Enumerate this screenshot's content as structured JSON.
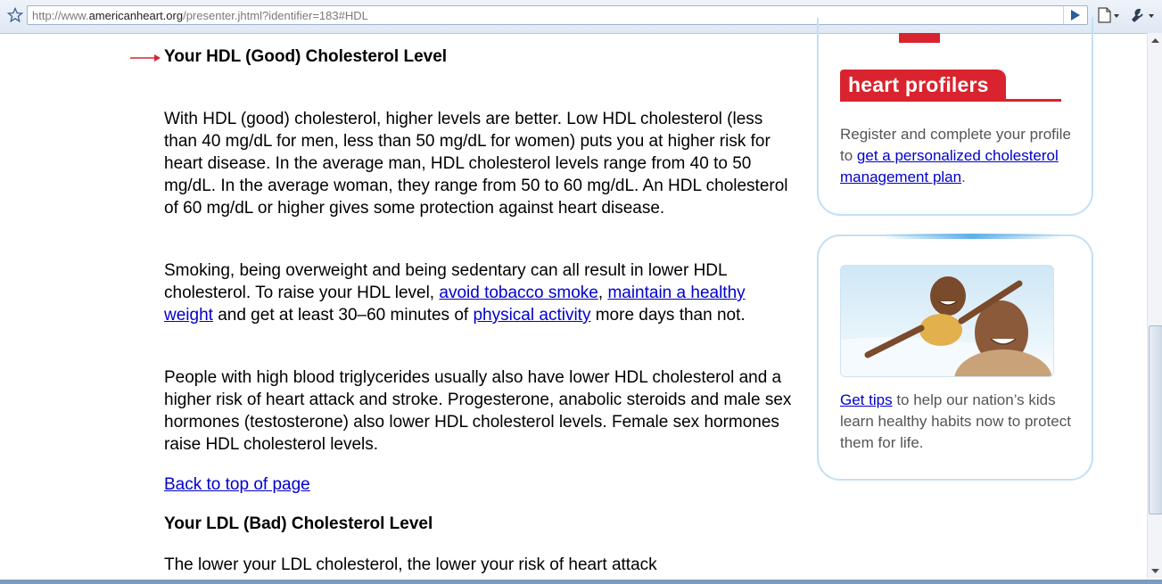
{
  "browser": {
    "url_prefix": "http://www.",
    "url_host": "americanheart.org",
    "url_rest": "/presenter.jhtml?identifier=183#HDL",
    "icons": [
      "star-icon",
      "go-arrow-icon",
      "page-icon",
      "wrench-icon"
    ]
  },
  "article": {
    "hdl_heading": "Your HDL (Good) Cholesterol Level",
    "p1": "With HDL (good) cholesterol, higher levels are better. Low HDL cholesterol (less than 40 mg/dL for men, less than 50 mg/dL for women) puts you at higher risk for heart disease. In the average man, HDL cholesterol levels range from 40 to 50 mg/dL. In the average woman, they range from 50 to 60 mg/dL. An HDL cholesterol of 60 mg/dL or higher gives some protection against heart disease.",
    "p2_a": "Smoking, being overweight and being sedentary can all result in lower HDL cholesterol. To raise your HDL level, ",
    "p2_link1": "avoid tobacco smoke",
    "p2_b": ", ",
    "p2_link2": "maintain a healthy weight",
    "p2_c": " and get at least 30–60 minutes of ",
    "p2_link3": "physical activity",
    "p2_d": " more days than not.",
    "p3": "People with high blood triglycerides usually also have lower HDL cholesterol and a higher risk of heart attack and stroke. Progesterone, anabolic steroids and male sex hormones (testosterone) also lower HDL cholesterol levels. Female sex hormones raise HDL cholesterol levels.",
    "back_link": "Back to top of page",
    "ldl_heading": "Your LDL (Bad) Cholesterol Level",
    "p4": "The lower your LDL cholesterol, the lower your risk of heart attack"
  },
  "sidebar": {
    "profilers_logo": "heart profilers",
    "box1_text_a": "Register and complete your profile to ",
    "box1_link": "get a personalized cholesterol management plan",
    "box1_text_b": ".",
    "box2_link": "Get tips",
    "box2_text": " to help our nation’s kids learn healthy habits now to protect them for life."
  },
  "colors": {
    "link": "#0000cc",
    "brand_red": "#d9232e",
    "box_border": "#c3e0f4"
  }
}
